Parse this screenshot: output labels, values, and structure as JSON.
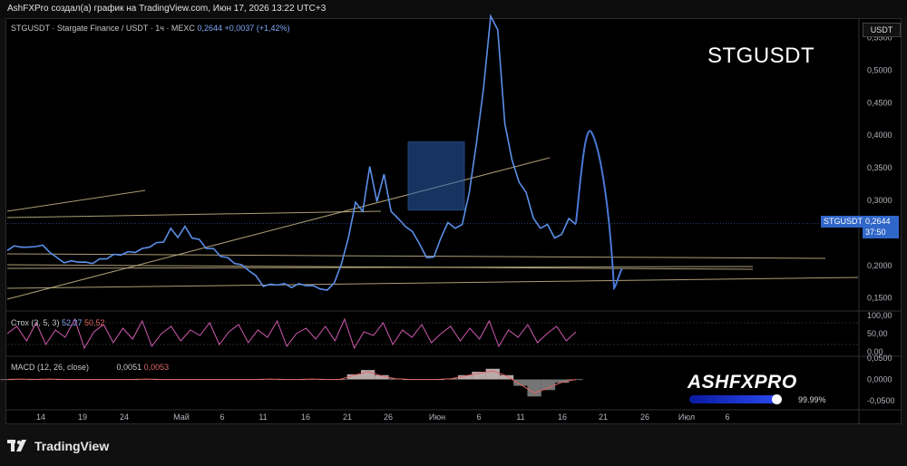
{
  "header": {
    "credit": "AshFXPro создал(а) график на TradingView.com, Июн 17, 2026 13:22 UTC+3"
  },
  "legend": {
    "symbol": "STGUSDT · Stargate Finance / USDT · 1ч · MEXC",
    "price": "0,2644",
    "change": "+0,0037 (+1,42%)"
  },
  "watermark_title": "STGUSDT",
  "currency_button": "USDT",
  "price_tag": {
    "symbol": "STGUSDT",
    "price": "0,2644",
    "timer": "37:50"
  },
  "stoch": {
    "label": "Стох (3, 5, 3)",
    "k": "52,27",
    "d": "50,52"
  },
  "macd": {
    "label": "MACD (12, 26, close)",
    "macd": "0,0051",
    "signal": "0,0053"
  },
  "brand": {
    "name": "TradingView"
  },
  "ashfx": {
    "name": "ASHFXPRO",
    "pct": "99.99%"
  },
  "colors": {
    "price_line": "#5b8fe8",
    "projection": "#4a78d8",
    "trend": "#c9b98a",
    "stoch": "#d05ab0",
    "macd_pos": "#d9c8c8",
    "macd_neg": "#8a8a8a",
    "box": "#2a5fb0"
  },
  "chart_data": [
    {
      "type": "line",
      "title": "STGUSDT",
      "ylabel": "",
      "y_axis_ticks": [
        "0,5500",
        "0,5000",
        "0,4500",
        "0,4000",
        "0,3500",
        "0,3000",
        "0,2500",
        "0,2000",
        "0,1500"
      ],
      "x_tick_labels": [
        "14",
        "19",
        "24",
        "Май",
        "6",
        "11",
        "16",
        "21",
        "26",
        "Июн",
        "6",
        "11",
        "16",
        "21",
        "26",
        "Июл",
        "6"
      ],
      "ylim": [
        0.13,
        0.58
      ],
      "series": [
        {
          "values": [
            0.225,
            0.228,
            0.23,
            0.226,
            0.231,
            0.229,
            0.222,
            0.21,
            0.206,
            0.205,
            0.207,
            0.203,
            0.205,
            0.208,
            0.212,
            0.215,
            0.218,
            0.219,
            0.222,
            0.224,
            0.23,
            0.233,
            0.238,
            0.255,
            0.245,
            0.258,
            0.244,
            0.238,
            0.228,
            0.224,
            0.216,
            0.21,
            0.205,
            0.199,
            0.194,
            0.182,
            0.17,
            0.169,
            0.172,
            0.17,
            0.168,
            0.17,
            0.171,
            0.167,
            0.166,
            0.16,
            0.175,
            0.2,
            0.245,
            0.295,
            0.285,
            0.35,
            0.3,
            0.338,
            0.285,
            0.27,
            0.262,
            0.25,
            0.235,
            0.21,
            0.215,
            0.24,
            0.268,
            0.255,
            0.265,
            0.31,
            0.39,
            0.47,
            0.585,
            0.56,
            0.42,
            0.36,
            0.33,
            0.31,
            0.275,
            0.255,
            0.265,
            0.24,
            0.25,
            0.27,
            0.265
          ]
        }
      ],
      "current_price": 0.2644,
      "box_range": [
        0.285,
        0.39
      ]
    },
    {
      "type": "line",
      "title": "Стох (3, 5, 3)",
      "y_axis_ticks": [
        "100,00",
        "50,00",
        "0,00"
      ],
      "ylim": [
        0,
        100
      ],
      "series": [
        {
          "name": "Стох (3, 5, 3)",
          "values": [
            50,
            70,
            30,
            80,
            20,
            60,
            40,
            90,
            10,
            55,
            75,
            25,
            65,
            35,
            85,
            15,
            50,
            70,
            30,
            60,
            45,
            80,
            20,
            55,
            75,
            25,
            60,
            40,
            85,
            15,
            50,
            65,
            35,
            70,
            30,
            90,
            10,
            55,
            45,
            80,
            20,
            60,
            40,
            75,
            25,
            50,
            70,
            30,
            65,
            35,
            85,
            15,
            60,
            40,
            75,
            25,
            50,
            70,
            30,
            55
          ]
        }
      ]
    },
    {
      "type": "area",
      "title": "MACD (12, 26, close)",
      "y_axis_ticks": [
        "0,0500",
        "0,0000",
        "-0,0500"
      ],
      "ylim": [
        -0.05,
        0.05
      ],
      "series": [
        {
          "name": "MACD (12, 26, close)",
          "values": [
            0.0,
            0.001,
            0.0,
            0.001,
            0.0,
            0.0,
            0.0,
            0.0,
            0.0,
            0.0,
            0.001,
            0.0,
            0.0,
            0.0,
            0.0,
            0.0,
            0.0,
            0.0,
            0.0,
            0.001,
            0.0,
            0.0,
            0.001,
            0.0,
            0.0,
            0.012,
            0.022,
            0.01,
            0.002,
            0.0,
            0.0,
            0.0,
            0.002,
            0.01,
            0.018,
            0.025,
            0.01,
            -0.015,
            -0.04,
            -0.025,
            -0.008,
            0.0
          ]
        }
      ]
    }
  ]
}
